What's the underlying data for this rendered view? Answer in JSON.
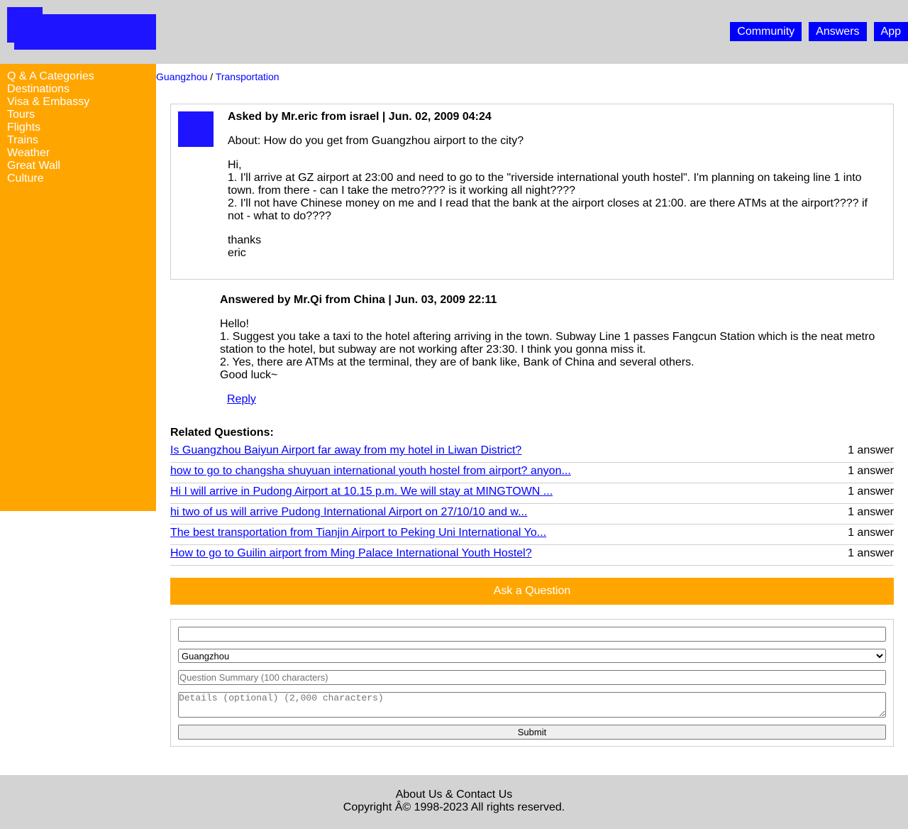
{
  "header": {
    "nav": [
      "Community",
      "Answers",
      "App"
    ]
  },
  "sidebar": {
    "items": [
      "Q & A Categories",
      "Destinations",
      "Visa & Embassy",
      "Tours",
      "Flights",
      "Trains",
      "Weather",
      "Great Wall",
      "Culture"
    ]
  },
  "breadcrumb": {
    "city": "Guangzhou",
    "separator": " / ",
    "category": "Transportation"
  },
  "question": {
    "meta": "Asked by Mr.eric from israel | Jun. 02, 2009 04:24",
    "about": "About: How do you get from Guangzhou airport to the city?",
    "lines": [
      "Hi,",
      "1. I'll arrive at GZ airport at 23:00 and need to go to the \"riverside international youth hostel\". I'm planning on takeing line 1 into town. from there - can I take the metro???? is it working all night????",
      "2. I'll not have Chinese money on me and I read that the bank at the airport closes at 21:00. are there ATMs at the airport???? if not - what to do????"
    ],
    "sign": [
      "thanks",
      "eric"
    ]
  },
  "answer": {
    "meta": "Answered by Mr.Qi from China | Jun. 03, 2009 22:11",
    "lines": [
      "Hello!",
      "1. Suggest you take a taxi to the hotel aftering arriving in the town. Subway Line 1 passes Fangcun Station which is the neat metro station to the hotel, but subway are not working after 23:30. I think you gonna miss it.",
      "2. Yes, there are ATMs at the terminal, they are of bank like, Bank of China and several others.",
      "Good luck~"
    ],
    "reply": "Reply"
  },
  "related": {
    "title": "Related Questions:",
    "items": [
      {
        "q": "Is Guangzhou Baiyun Airport far away from my hotel in Liwan District?",
        "count": "1 answer"
      },
      {
        "q": "how to go to changsha shuyuan international youth hostel from airport? anyon...",
        "count": "1 answer"
      },
      {
        "q": "Hi I will arrive in Pudong Airport at 10.15 p.m. We will stay at MINGTOWN ...",
        "count": "1 answer"
      },
      {
        "q": "hi two of us will arrive Pudong International Airport on 27/10/10 and w...",
        "count": "1 answer"
      },
      {
        "q": "The best transportation from Tianjin Airport to Peking Uni International Yo...",
        "count": "1 answer"
      },
      {
        "q": "How to go to Guilin airport from Ming Palace International Youth Hostel?",
        "count": "1 answer"
      }
    ]
  },
  "ask": {
    "button": "Ask a Question",
    "name_value": "",
    "city_selected": "Guangzhou",
    "summary_placeholder": "Question Summary (100 characters)",
    "details_placeholder": "Details (optional) (2,000 characters)",
    "submit": "Submit"
  },
  "footer": {
    "links": "About Us & Contact Us",
    "copyright": "Copyright Â© 1998-2023 All rights reserved."
  },
  "colors": {
    "header_bg": "#d3d3d3",
    "logo": "#1f14ff",
    "nav_bg": "#0000ff",
    "sidebar_bg": "#ffa500",
    "accent_orange": "#ffa500",
    "link": "#0000ff"
  }
}
